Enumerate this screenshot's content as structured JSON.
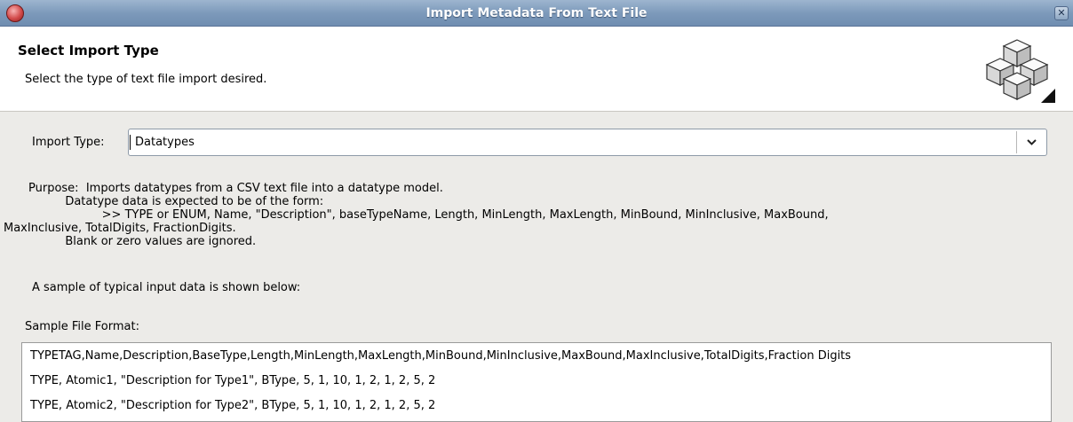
{
  "window": {
    "title": "Import Metadata From Text File",
    "close_glyph": "✕",
    "app_icon": "eclipse-icon"
  },
  "banner": {
    "title": "Select Import Type",
    "description": "Select the type of text file import desired.",
    "image": "import-cubes-icon"
  },
  "form": {
    "import_type_label": "Import Type:",
    "import_type_value": "Datatypes"
  },
  "purpose": {
    "line1": "Purpose:  Imports datatypes from a CSV text file into a datatype model.",
    "line2": "          Datatype data is expected to be of the form:",
    "line3": "                    >> TYPE or ENUM, Name, \"Description\", baseTypeName, Length, MinLength, MaxLength, MinBound, MinInclusive, MaxBound,",
    "line4": "MaxInclusive, TotalDigits, FractionDigits.",
    "line5": "          Blank or zero values are ignored."
  },
  "sample": {
    "note": "A sample of typical input data is shown below:",
    "label": "Sample File Format:",
    "lines": [
      "TYPETAG,Name,Description,BaseType,Length,MinLength,MaxLength,MinBound,MinInclusive,MaxBound,MaxInclusive,TotalDigits,Fraction Digits",
      "TYPE, Atomic1, \"Description for Type1\", BType, 5, 1, 10, 1, 2, 1, 2, 5, 2",
      "TYPE, Atomic2, \"Description for Type2\", BType, 5, 1, 10, 1, 2, 1, 2, 5, 2"
    ]
  }
}
